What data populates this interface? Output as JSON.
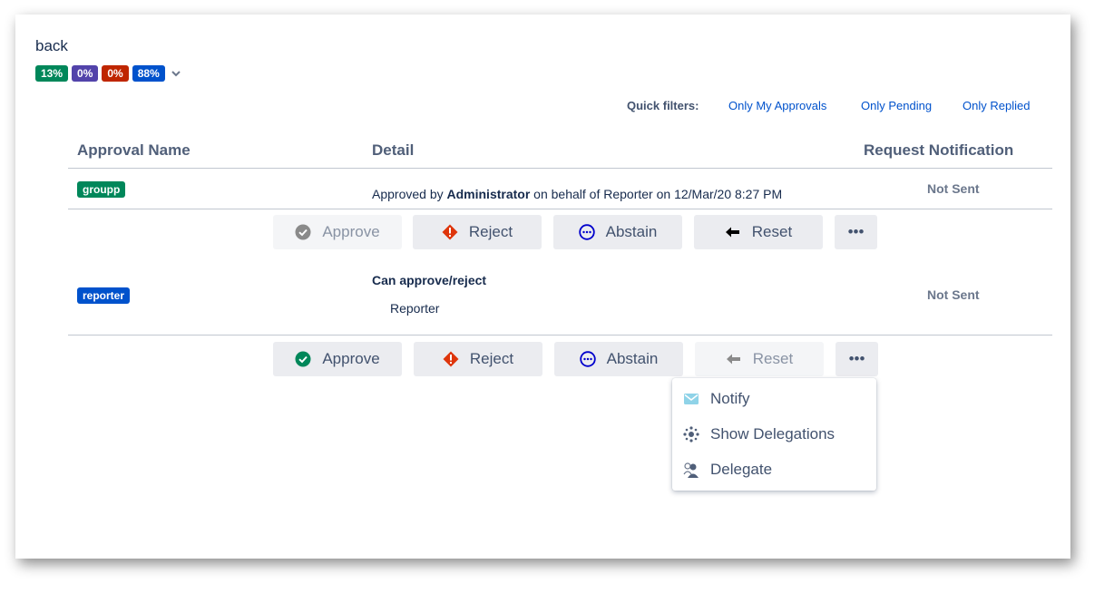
{
  "back_label": "back",
  "progress_badges": [
    {
      "label": "13%",
      "color": "#00875a"
    },
    {
      "label": "0%",
      "color": "#5243aa"
    },
    {
      "label": "0%",
      "color": "#bf2600"
    },
    {
      "label": "88%",
      "color": "#0052cc"
    }
  ],
  "quick_filters": {
    "label": "Quick filters:",
    "links": [
      "Only My Approvals",
      "Only Pending",
      "Only Replied"
    ]
  },
  "table": {
    "headers": [
      "Approval Name",
      "Detail",
      "Request Notification"
    ],
    "rows": [
      {
        "name": "groupp",
        "name_color": "#00875a",
        "detail_prefix": "Approved by ",
        "detail_user": "Administrator",
        "detail_suffix": " on behalf of Reporter on 12/Mar/20 8:27 PM",
        "notification": "Not Sent"
      },
      {
        "name": "reporter",
        "name_color": "#0052cc",
        "detail_title": "Can approve/reject",
        "detail_user": "Reporter",
        "notification": "Not Sent"
      }
    ]
  },
  "actions": {
    "approve": "Approve",
    "reject": "Reject",
    "abstain": "Abstain",
    "reset": "Reset",
    "more": "•••"
  },
  "more_menu": {
    "items": [
      {
        "label": "Notify",
        "icon": "envelope-icon"
      },
      {
        "label": "Show Delegations",
        "icon": "delegations-icon"
      },
      {
        "label": "Delegate",
        "icon": "delegate-user-icon"
      }
    ]
  },
  "colors": {
    "approve_green": "#00875a",
    "reject_red": "#de350b",
    "abstain_blue": "#0000cc",
    "link_blue": "#0052cc"
  }
}
